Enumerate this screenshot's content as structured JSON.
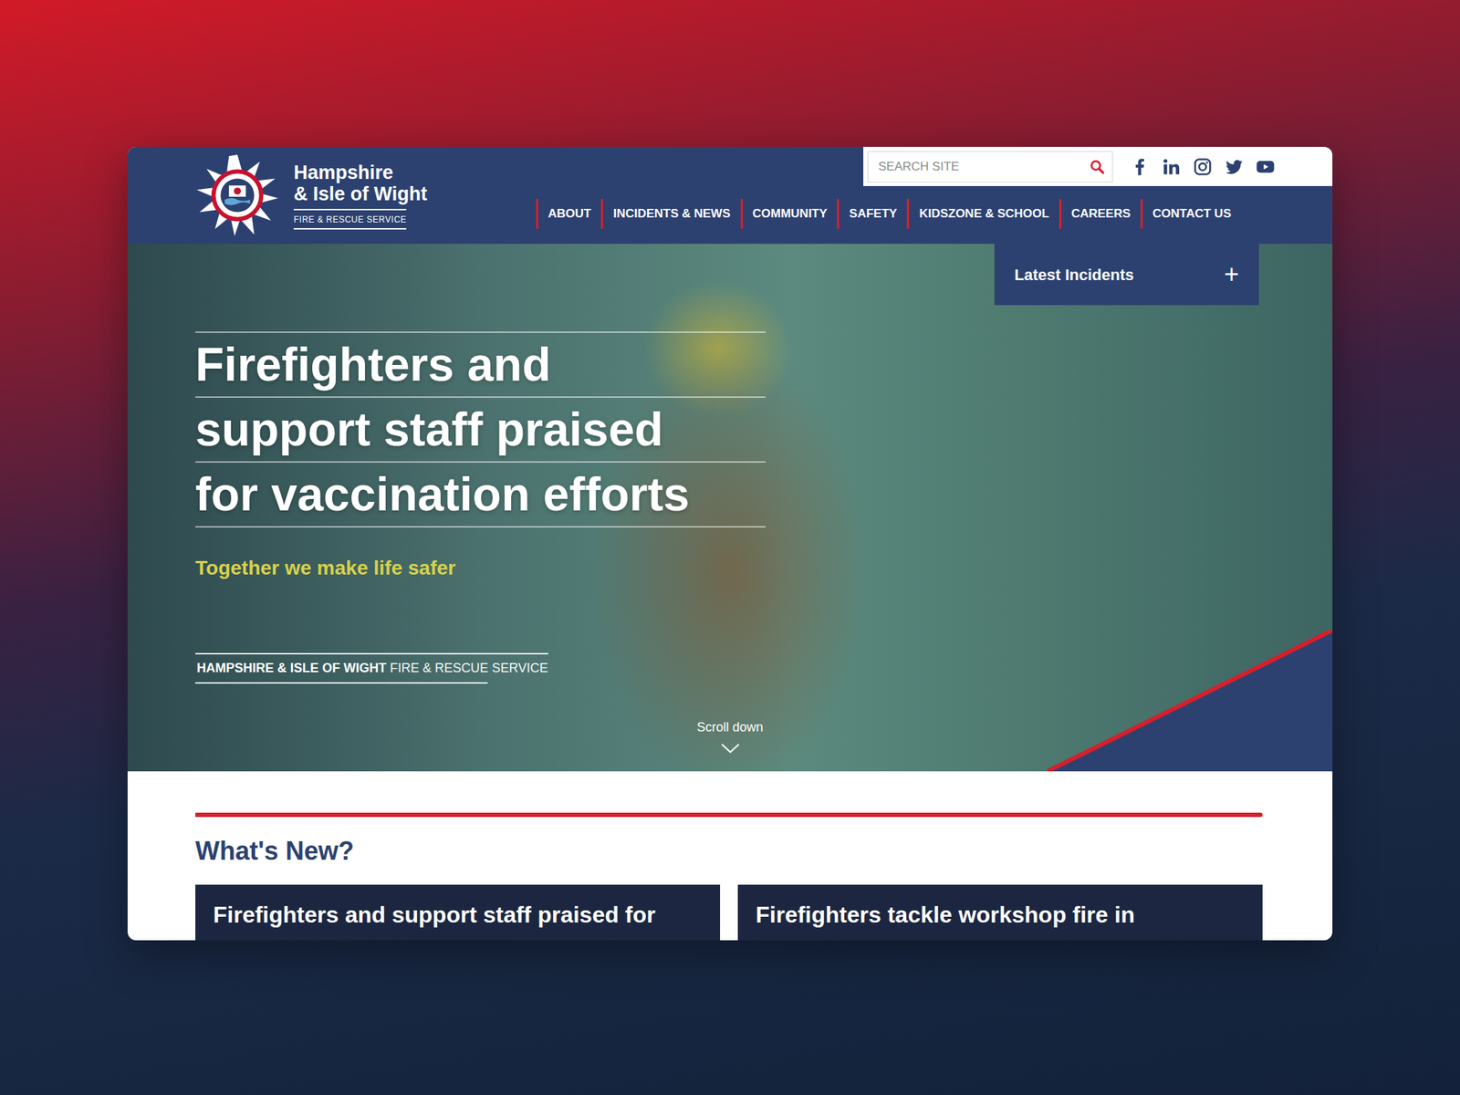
{
  "header": {
    "logo": {
      "line1": "Hampshire",
      "line2": "& Isle of Wight",
      "line3": "FIRE & RESCUE SERVICE"
    },
    "search": {
      "placeholder": "SEARCH SITE"
    },
    "nav": [
      {
        "label": "ABOUT"
      },
      {
        "label": "INCIDENTS & NEWS"
      },
      {
        "label": "COMMUNITY"
      },
      {
        "label": "SAFETY"
      },
      {
        "label": "KIDSZONE & SCHOOL"
      },
      {
        "label": "CAREERS"
      },
      {
        "label": "CONTACT US"
      }
    ]
  },
  "latest_incidents": {
    "label": "Latest Incidents",
    "toggle": "+",
    "expanded": false
  },
  "hero": {
    "headline": [
      "Firefighters and",
      "support staff praised",
      "for vaccination efforts"
    ],
    "tagline": "Together we make life safer",
    "brand": {
      "bold": "HAMPSHIRE & ISLE OF WIGHT",
      "light": "FIRE & RESCUE SERVICE"
    },
    "scroll": "Scroll down"
  },
  "whats_new": {
    "title": "What's New?",
    "cards": [
      {
        "title": "Firefighters and support staff praised for"
      },
      {
        "title": "Firefighters tackle workshop fire in"
      }
    ]
  }
}
